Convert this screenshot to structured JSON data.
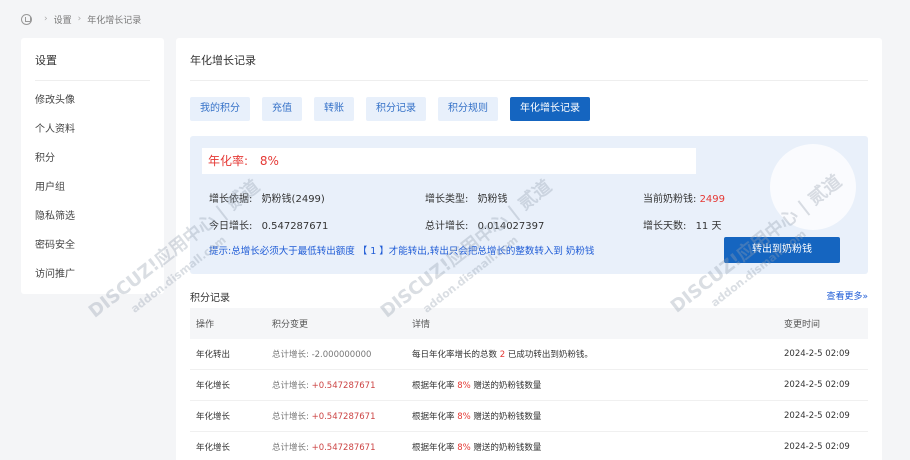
{
  "breadcrumb": {
    "items": [
      "设置",
      "年化增长记录"
    ]
  },
  "sidebar": {
    "title": "设置",
    "items": [
      {
        "label": "修改头像"
      },
      {
        "label": "个人资料"
      },
      {
        "label": "积分"
      },
      {
        "label": "用户组"
      },
      {
        "label": "隐私筛选"
      },
      {
        "label": "密码安全"
      },
      {
        "label": "访问推广"
      }
    ]
  },
  "main": {
    "title": "年化增长记录",
    "tabs": [
      {
        "label": "我的积分"
      },
      {
        "label": "充值"
      },
      {
        "label": "转账"
      },
      {
        "label": "积分记录"
      },
      {
        "label": "积分规则"
      },
      {
        "label": "年化增长记录",
        "active": true
      }
    ],
    "panel": {
      "rate_label": "年化率:",
      "rate_value": "8%",
      "growth_basis_label": "增长依据:",
      "growth_basis_value": "奶粉钱(2499)",
      "growth_type_label": "增长类型:",
      "growth_type_value": "奶粉钱",
      "current_label": "当前奶粉钱:",
      "current_value": "2499",
      "today_label": "今日增长:",
      "today_value": "0.547287671",
      "total_label": "总计增长:",
      "total_value": "0.014027397",
      "days_label": "增长天数:",
      "days_value": "11 天",
      "tip": "提示:总增长必须大于最低转出额度 【 1 】才能转出,转出只会把总增长的整数转入到 奶粉钱",
      "transfer_button": "转出到奶粉钱"
    },
    "records": {
      "title": "积分记录",
      "more": "查看更多»",
      "headers": [
        "操作",
        "积分变更",
        "详情",
        "变更时间"
      ],
      "rows": [
        {
          "op": "年化转出",
          "change_label": "总计增长:",
          "change_value": "-2.000000000",
          "detail_a": "每日年化率增长的总数",
          "detail_num": "2",
          "detail_b": "已成功转出到奶粉钱。",
          "time": "2024-2-5 02:09"
        },
        {
          "op": "年化增长",
          "change_label": "总计增长:",
          "change_value": "+0.547287671",
          "detail_a": "根据年化率",
          "detail_num": "8%",
          "detail_b": "赠送的奶粉钱数量",
          "time": "2024-2-5 02:09"
        },
        {
          "op": "年化增长",
          "change_label": "总计增长:",
          "change_value": "+0.547287671",
          "detail_a": "根据年化率",
          "detail_num": "8%",
          "detail_b": "赠送的奶粉钱数量",
          "time": "2024-2-5 02:09"
        },
        {
          "op": "年化增长",
          "change_label": "总计增长:",
          "change_value": "+0.547287671",
          "detail_a": "根据年化率",
          "detail_num": "8%",
          "detail_b": "赠送的奶粉钱数量",
          "time": "2024-2-5 02:09"
        }
      ]
    }
  },
  "watermark": {
    "text_a": "DISCUZ!应用中心 | 贰道",
    "text_b": "addon.dismall.com"
  }
}
